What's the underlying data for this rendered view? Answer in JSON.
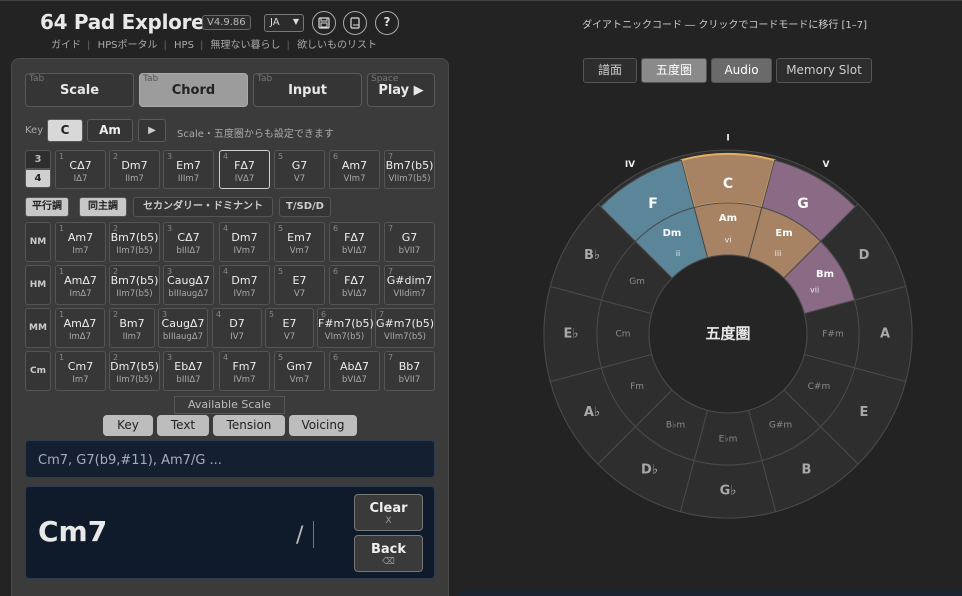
{
  "app": {
    "title": "64 Pad Explorer",
    "version": "V4.9.86",
    "lang": "JA",
    "nav": [
      "ガイド",
      "HPSポータル",
      "HPS",
      "無理ない暮らし",
      "欲しいものリスト"
    ]
  },
  "tabs": [
    {
      "hint": "Tab",
      "label": "Scale"
    },
    {
      "hint": "Tab",
      "label": "Chord"
    },
    {
      "hint": "Tab",
      "label": "Input"
    },
    {
      "hint": "Space",
      "label": "Play ▶"
    }
  ],
  "keyrow": {
    "label": "Key",
    "major": "C",
    "minor": "Am",
    "play": "▶",
    "note": "Scale・五度圏からも設定できます"
  },
  "switch": {
    "a": "3",
    "b": "4"
  },
  "diatonic": [
    {
      "n": "1",
      "c": "CΔ7",
      "r": "IΔ7"
    },
    {
      "n": "2",
      "c": "Dm7",
      "r": "IIm7"
    },
    {
      "n": "3",
      "c": "Em7",
      "r": "IIIm7"
    },
    {
      "n": "4",
      "c": "FΔ7",
      "r": "IVΔ7"
    },
    {
      "n": "5",
      "c": "G7",
      "r": "V7"
    },
    {
      "n": "6",
      "c": "Am7",
      "r": "VIm7"
    },
    {
      "n": "7",
      "c": "Bm7(b5)",
      "r": "VIIm7(b5)"
    }
  ],
  "modes": [
    "平行調",
    "同主調",
    "セカンダリー・ドミナント",
    "T/SD/D"
  ],
  "rows": [
    {
      "label": "NM",
      "pads": [
        {
          "n": "1",
          "c": "Am7",
          "r": "Im7"
        },
        {
          "n": "2",
          "c": "Bm7(b5)",
          "r": "IIm7(b5)"
        },
        {
          "n": "3",
          "c": "CΔ7",
          "r": "bIIIΔ7"
        },
        {
          "n": "4",
          "c": "Dm7",
          "r": "IVm7"
        },
        {
          "n": "5",
          "c": "Em7",
          "r": "Vm7"
        },
        {
          "n": "6",
          "c": "FΔ7",
          "r": "bVIΔ7"
        },
        {
          "n": "7",
          "c": "G7",
          "r": "bVII7"
        }
      ]
    },
    {
      "label": "HM",
      "pads": [
        {
          "n": "1",
          "c": "AmΔ7",
          "r": "ImΔ7"
        },
        {
          "n": "2",
          "c": "Bm7(b5)",
          "r": "IIm7(b5)"
        },
        {
          "n": "3",
          "c": "CaugΔ7",
          "r": "bIIIaugΔ7"
        },
        {
          "n": "4",
          "c": "Dm7",
          "r": "IVm7"
        },
        {
          "n": "5",
          "c": "E7",
          "r": "V7"
        },
        {
          "n": "6",
          "c": "FΔ7",
          "r": "bVIΔ7"
        },
        {
          "n": "7",
          "c": "G#dim7",
          "r": "VIIdim7"
        }
      ]
    },
    {
      "label": "MM",
      "pads": [
        {
          "n": "1",
          "c": "AmΔ7",
          "r": "ImΔ7"
        },
        {
          "n": "2",
          "c": "Bm7",
          "r": "IIm7"
        },
        {
          "n": "3",
          "c": "CaugΔ7",
          "r": "bIIIaugΔ7"
        },
        {
          "n": "4",
          "c": "D7",
          "r": "IV7"
        },
        {
          "n": "5",
          "c": "E7",
          "r": "V7"
        },
        {
          "n": "6",
          "c": "F#m7(b5)",
          "r": "VIm7(b5)"
        },
        {
          "n": "7",
          "c": "G#m7(b5)",
          "r": "VIIm7(b5)"
        }
      ]
    },
    {
      "label": "Cm",
      "pads": [
        {
          "n": "1",
          "c": "Cm7",
          "r": "Im7"
        },
        {
          "n": "2",
          "c": "Dm7(b5)",
          "r": "IIm7(b5)"
        },
        {
          "n": "3",
          "c": "EbΔ7",
          "r": "bIIIΔ7"
        },
        {
          "n": "4",
          "c": "Fm7",
          "r": "IVm7"
        },
        {
          "n": "5",
          "c": "Gm7",
          "r": "Vm7"
        },
        {
          "n": "6",
          "c": "AbΔ7",
          "r": "bVIΔ7"
        },
        {
          "n": "7",
          "c": "Bb7",
          "r": "bVII7"
        }
      ]
    }
  ],
  "available_scale": "Available Scale",
  "subtabs": [
    "Key",
    "Text",
    "Tension",
    "Voicing"
  ],
  "chord_input": {
    "placeholder": "Cm7, G7(b9,#11), Am7/G ..."
  },
  "display": {
    "chord": "Cm7",
    "slash": "/"
  },
  "actions": {
    "clear": "Clear",
    "clear_key": "X",
    "back": "Back",
    "back_key": "⌫"
  },
  "right": {
    "header": "ダイアトニックコード ― クリックでコードモードに移行 [1–7]",
    "buttons": [
      "譜面",
      "五度圏",
      "Audio",
      "Memory Slot"
    ]
  },
  "circle": {
    "center": "五度圏",
    "outer": [
      "C",
      "G",
      "D",
      "A",
      "E",
      "B",
      "G♭",
      "D♭",
      "A♭",
      "E♭",
      "B♭",
      "F"
    ],
    "inner": [
      "Am",
      "Em",
      "Bm",
      "F#m",
      "C#m",
      "G#m",
      "E♭m",
      "B♭m",
      "Fm",
      "Cm",
      "Gm",
      "Dm"
    ],
    "roman_outer": {
      "0": "I",
      "1": "V",
      "11": "IV"
    },
    "roman_inner": {
      "0": "vi",
      "1": "iii",
      "2": "vii",
      "11": "ii"
    },
    "colors": {
      "tonic": "#a88363",
      "tonic_border": "#e0b060",
      "dominant": "#8a6a85",
      "subdominant": "#5b8699",
      "bg": "#2e2e2e",
      "line": "#4a4a4a"
    }
  }
}
